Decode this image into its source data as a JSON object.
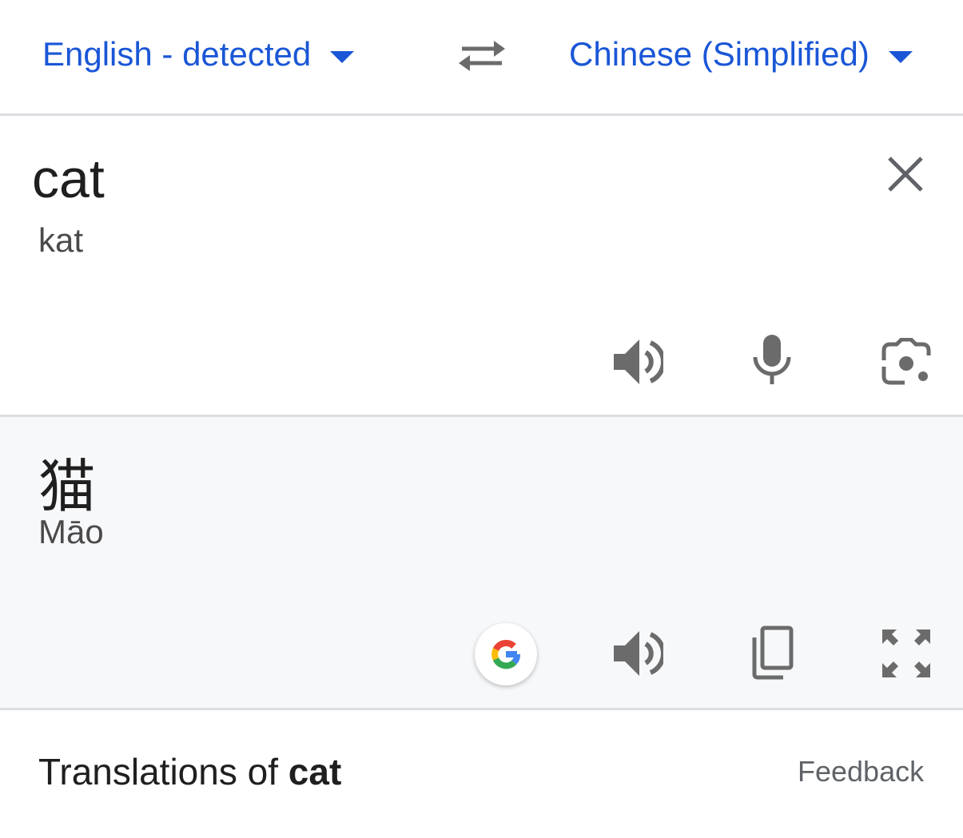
{
  "language_bar": {
    "source_language": "English - detected",
    "target_language": "Chinese (Simplified)"
  },
  "source_panel": {
    "text": "cat",
    "transliteration": "kat",
    "icons": [
      "close-icon",
      "speaker-icon",
      "microphone-icon",
      "camera-icon"
    ]
  },
  "output_panel": {
    "text": "猫",
    "transliteration": "Māo",
    "icons": [
      "google-logo-icon",
      "speaker-icon",
      "copy-icon",
      "fullscreen-icon"
    ]
  },
  "footer": {
    "title_prefix": "Translations of ",
    "title_word": "cat",
    "feedback_label": "Feedback"
  },
  "colors": {
    "accent": "#1a56d6",
    "icon_gray": "#6b6b6b",
    "output_bg": "#f7f8fa"
  }
}
